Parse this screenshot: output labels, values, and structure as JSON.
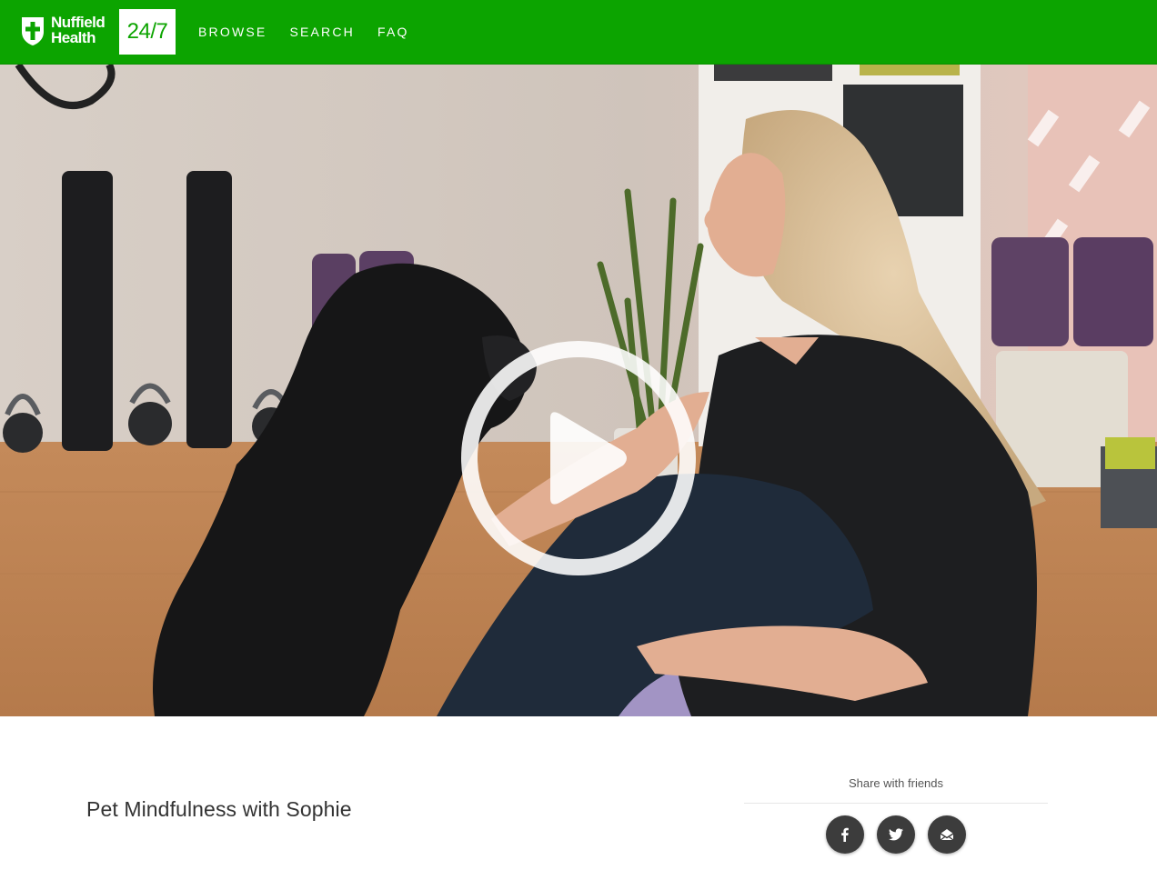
{
  "brand": {
    "name_line1": "Nuffield",
    "name_line2": "Health",
    "badge": "24/7",
    "color": "#0ca400"
  },
  "nav": {
    "items": [
      {
        "label": "BROWSE"
      },
      {
        "label": "SEARCH"
      },
      {
        "label": "FAQ"
      }
    ]
  },
  "video": {
    "play_icon": "play-icon"
  },
  "content": {
    "title": "Pet Mindfulness with Sophie"
  },
  "share": {
    "label": "Share with friends",
    "buttons": [
      {
        "icon": "facebook-icon"
      },
      {
        "icon": "twitter-icon"
      },
      {
        "icon": "email-icon"
      }
    ]
  }
}
